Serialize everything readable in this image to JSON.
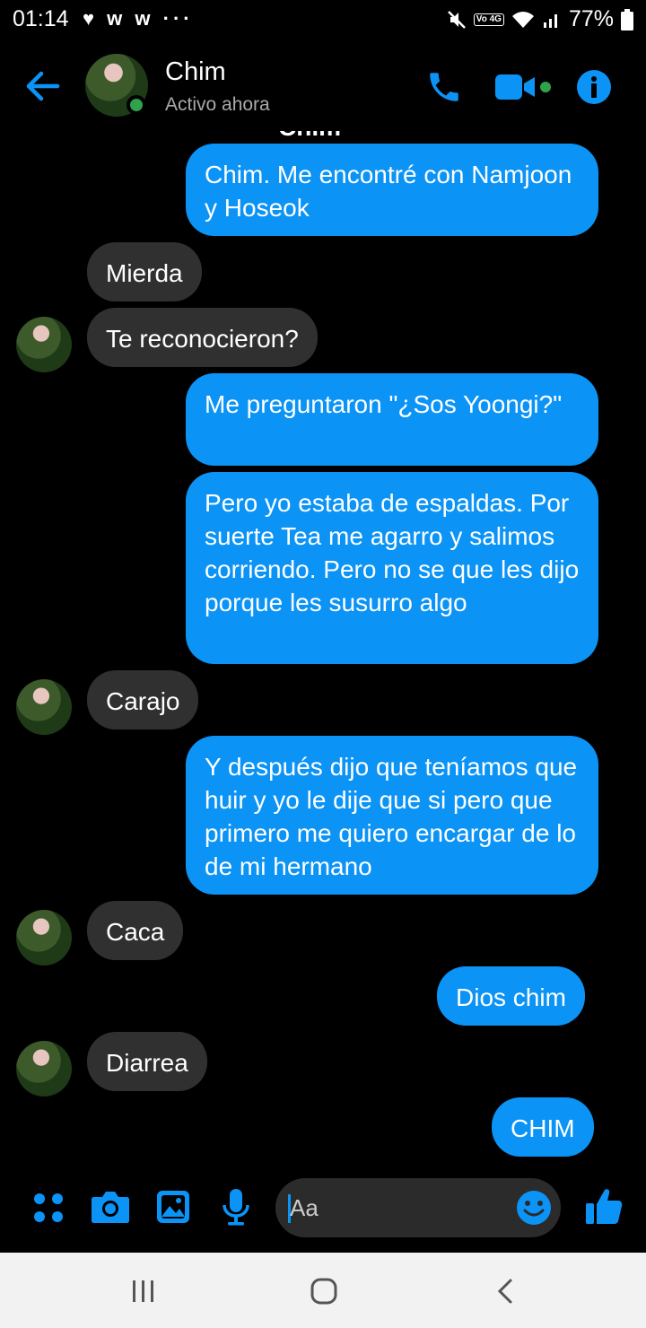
{
  "status_bar": {
    "time": "01:14",
    "left_icons": "♥ w w ···",
    "volte": "Vo 4G",
    "battery": "77%"
  },
  "header": {
    "contact_name": "Chim",
    "contact_status": "Activo ahora",
    "partial_name_above": "Chim"
  },
  "messages": [
    {
      "dir": "out",
      "text": "Chim. Me encontré con Namjoon y Hoseok"
    },
    {
      "dir": "in",
      "text": "Mierda"
    },
    {
      "dir": "in",
      "text": "Te reconocieron?"
    },
    {
      "dir": "out",
      "text": "Me preguntaron \"¿Sos Yoongi?\""
    },
    {
      "dir": "out",
      "text": "Pero yo estaba de espaldas. Por suerte Tea me agarro y salimos corriendo. Pero no se que les dijo porque les susurro algo"
    },
    {
      "dir": "in",
      "text": "Carajo"
    },
    {
      "dir": "out",
      "text": "Y después dijo que teníamos que huir  y yo le dije que si pero que primero me quiero encargar de lo de mi hermano"
    },
    {
      "dir": "in",
      "text": "Caca"
    },
    {
      "dir": "out",
      "text": "Dios chim"
    },
    {
      "dir": "in",
      "text": "Diarrea"
    },
    {
      "dir": "out",
      "text": "CHIM"
    }
  ],
  "composer": {
    "placeholder": "Aa"
  },
  "colors": {
    "accent": "#0b93f6",
    "incoming_bubble": "#303030",
    "background": "#000000",
    "online": "#31a24c"
  },
  "icons": [
    "back-arrow-icon",
    "phone-icon",
    "video-icon",
    "info-icon",
    "menu-dots-icon",
    "camera-icon",
    "gallery-icon",
    "microphone-icon",
    "emoji-icon",
    "thumbs-up-icon",
    "recents-icon",
    "home-icon",
    "nav-back-icon"
  ]
}
